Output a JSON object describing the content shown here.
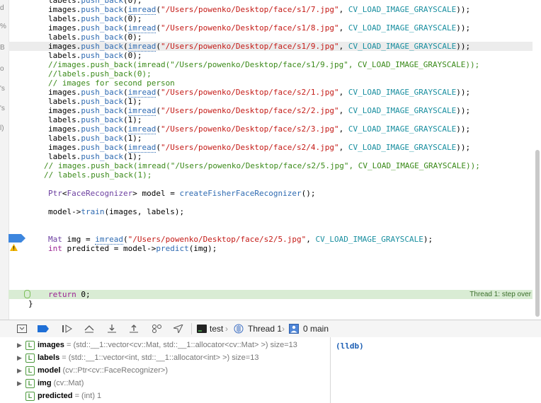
{
  "gutter_letters": [
    "d",
    "%",
    "B",
    "o",
    "'s",
    "'s",
    "l)"
  ],
  "code": {
    "lines": [
      [
        {
          "t": "labels.",
          "c": ""
        },
        {
          "t": "push_back",
          "c": "fn"
        },
        {
          "t": "(0);",
          "c": ""
        }
      ],
      [
        {
          "t": "images.",
          "c": ""
        },
        {
          "t": "push_back",
          "c": "fn"
        },
        {
          "t": "(",
          "c": ""
        },
        {
          "t": "imread",
          "c": "ufn"
        },
        {
          "t": "(",
          "c": ""
        },
        {
          "t": "\"/Users/powenko/Desktop/face/s1/7.jpg\"",
          "c": "str"
        },
        {
          "t": ", ",
          "c": ""
        },
        {
          "t": "CV_LOAD_IMAGE_GRAYSCALE",
          "c": "const"
        },
        {
          "t": "));",
          "c": ""
        }
      ],
      [
        {
          "t": "labels.",
          "c": ""
        },
        {
          "t": "push_back",
          "c": "fn"
        },
        {
          "t": "(0);",
          "c": ""
        }
      ],
      [
        {
          "t": "images.",
          "c": ""
        },
        {
          "t": "push_back",
          "c": "fn"
        },
        {
          "t": "(",
          "c": ""
        },
        {
          "t": "imread",
          "c": "ufn"
        },
        {
          "t": "(",
          "c": ""
        },
        {
          "t": "\"/Users/powenko/Desktop/face/s1/8.jpg\"",
          "c": "str"
        },
        {
          "t": ", ",
          "c": ""
        },
        {
          "t": "CV_LOAD_IMAGE_GRAYSCALE",
          "c": "const"
        },
        {
          "t": "));",
          "c": ""
        }
      ],
      [
        {
          "t": "labels.",
          "c": ""
        },
        {
          "t": "push_back",
          "c": "fn"
        },
        {
          "t": "(0);",
          "c": ""
        }
      ],
      [
        {
          "t": "images.",
          "c": ""
        },
        {
          "t": "push_back",
          "c": "fn"
        },
        {
          "t": "(",
          "c": ""
        },
        {
          "t": "imread",
          "c": "ufn"
        },
        {
          "t": "(",
          "c": ""
        },
        {
          "t": "\"/Users/powenko/Desktop/face/s1/9.jpg\"",
          "c": "str"
        },
        {
          "t": ", ",
          "c": ""
        },
        {
          "t": "CV_LOAD_IMAGE_GRAYSCALE",
          "c": "const"
        },
        {
          "t": "));",
          "c": ""
        }
      ],
      [
        {
          "t": "labels.",
          "c": ""
        },
        {
          "t": "push_back",
          "c": "fn"
        },
        {
          "t": "(0);",
          "c": ""
        }
      ],
      [
        {
          "t": "//images.push_back(imread(\"/Users/powenko/Desktop/face/s1/9.jpg\", CV_LOAD_IMAGE_GRAYSCALE));",
          "c": "cmt"
        }
      ],
      [
        {
          "t": "//labels.push_back(0);",
          "c": "cmt"
        }
      ],
      [
        {
          "t": "// images for second person",
          "c": "cmt"
        }
      ],
      [
        {
          "t": "images.",
          "c": ""
        },
        {
          "t": "push_back",
          "c": "fn"
        },
        {
          "t": "(",
          "c": ""
        },
        {
          "t": "imread",
          "c": "ufn"
        },
        {
          "t": "(",
          "c": ""
        },
        {
          "t": "\"/Users/powenko/Desktop/face/s2/1.jpg\"",
          "c": "str"
        },
        {
          "t": ", ",
          "c": ""
        },
        {
          "t": "CV_LOAD_IMAGE_GRAYSCALE",
          "c": "const"
        },
        {
          "t": "));",
          "c": ""
        }
      ],
      [
        {
          "t": "labels.",
          "c": ""
        },
        {
          "t": "push_back",
          "c": "fn"
        },
        {
          "t": "(1);",
          "c": ""
        }
      ],
      [
        {
          "t": "images.",
          "c": ""
        },
        {
          "t": "push_back",
          "c": "fn"
        },
        {
          "t": "(",
          "c": ""
        },
        {
          "t": "imread",
          "c": "ufn"
        },
        {
          "t": "(",
          "c": ""
        },
        {
          "t": "\"/Users/powenko/Desktop/face/s2/2.jpg\"",
          "c": "str"
        },
        {
          "t": ", ",
          "c": ""
        },
        {
          "t": "CV_LOAD_IMAGE_GRAYSCALE",
          "c": "const"
        },
        {
          "t": "));",
          "c": ""
        }
      ],
      [
        {
          "t": "labels.",
          "c": ""
        },
        {
          "t": "push_back",
          "c": "fn"
        },
        {
          "t": "(1);",
          "c": ""
        }
      ],
      [
        {
          "t": "images.",
          "c": ""
        },
        {
          "t": "push_back",
          "c": "fn"
        },
        {
          "t": "(",
          "c": ""
        },
        {
          "t": "imread",
          "c": "ufn"
        },
        {
          "t": "(",
          "c": ""
        },
        {
          "t": "\"/Users/powenko/Desktop/face/s2/3.jpg\"",
          "c": "str"
        },
        {
          "t": ", ",
          "c": ""
        },
        {
          "t": "CV_LOAD_IMAGE_GRAYSCALE",
          "c": "const"
        },
        {
          "t": "));",
          "c": ""
        }
      ],
      [
        {
          "t": "labels.",
          "c": ""
        },
        {
          "t": "push_back",
          "c": "fn"
        },
        {
          "t": "(1);",
          "c": ""
        }
      ],
      [
        {
          "t": "images.",
          "c": ""
        },
        {
          "t": "push_back",
          "c": "fn"
        },
        {
          "t": "(",
          "c": ""
        },
        {
          "t": "imread",
          "c": "ufn"
        },
        {
          "t": "(",
          "c": ""
        },
        {
          "t": "\"/Users/powenko/Desktop/face/s2/4.jpg\"",
          "c": "str"
        },
        {
          "t": ", ",
          "c": ""
        },
        {
          "t": "CV_LOAD_IMAGE_GRAYSCALE",
          "c": "const"
        },
        {
          "t": "));",
          "c": ""
        }
      ],
      [
        {
          "t": "labels.",
          "c": ""
        },
        {
          "t": "push_back",
          "c": "fn"
        },
        {
          "t": "(1);",
          "c": ""
        }
      ],
      [
        {
          "t": "// images.push_back(imread(\"/Users/powenko/Desktop/face/s2/5.jpg\", CV_LOAD_IMAGE_GRAYSCALE));",
          "c": "cmt"
        }
      ],
      [
        {
          "t": "// labels.push_back(1);",
          "c": "cmt"
        }
      ],
      [],
      [
        {
          "t": "Ptr",
          "c": "type"
        },
        {
          "t": "<",
          "c": ""
        },
        {
          "t": "FaceRecognizer",
          "c": "type"
        },
        {
          "t": "> model = ",
          "c": ""
        },
        {
          "t": "createFisherFaceRecognizer",
          "c": "fn"
        },
        {
          "t": "();",
          "c": ""
        }
      ],
      [],
      [
        {
          "t": "model->",
          "c": ""
        },
        {
          "t": "train",
          "c": "fn"
        },
        {
          "t": "(images, labels);",
          "c": ""
        }
      ],
      [],
      [],
      [
        {
          "t": "Mat",
          "c": "type"
        },
        {
          "t": " img = ",
          "c": ""
        },
        {
          "t": "imread",
          "c": "ufn"
        },
        {
          "t": "(",
          "c": ""
        },
        {
          "t": "\"/Users/powenko/Desktop/face/s2/5.jpg\"",
          "c": "str"
        },
        {
          "t": ", ",
          "c": ""
        },
        {
          "t": "CV_LOAD_IMAGE_GRAYSCALE",
          "c": "const"
        },
        {
          "t": ");",
          "c": ""
        }
      ],
      [
        {
          "t": "int",
          "c": "kw"
        },
        {
          "t": " predicted = model->",
          "c": ""
        },
        {
          "t": "predict",
          "c": "fn"
        },
        {
          "t": "(img);",
          "c": ""
        }
      ],
      [],
      [],
      [],
      [],
      [
        {
          "t": "return",
          "c": "kw"
        },
        {
          "t": " 0;",
          "c": ""
        }
      ],
      [
        {
          "t": "}",
          "c": ""
        }
      ]
    ],
    "step_over_label": "Thread 1: step over"
  },
  "debug_bar": {
    "target": "test",
    "thread": "Thread 1",
    "frame": "0 main"
  },
  "variables": [
    {
      "name": "images",
      "detail": " = (std::__1::vector<cv::Mat, std::__1::allocator<cv::Mat> >) size=13",
      "value": ""
    },
    {
      "name": "labels",
      "detail": " = (std::__1::vector<int, std::__1::allocator<int> >) size=13",
      "value": ""
    },
    {
      "name": "model",
      "detail": " (cv::Ptr<cv::FaceRecognizer>)",
      "value": ""
    },
    {
      "name": "img",
      "detail": " (cv::Mat)",
      "value": ""
    },
    {
      "name": "predicted",
      "detail": " = (int) 1",
      "value": ""
    }
  ],
  "console": {
    "prompt": "(lldb)"
  },
  "colors": {
    "accent": "#1f6fd6",
    "current_line": "#d9ecd4",
    "breakpoint": "#3d86de",
    "warning": "#f1b400"
  }
}
